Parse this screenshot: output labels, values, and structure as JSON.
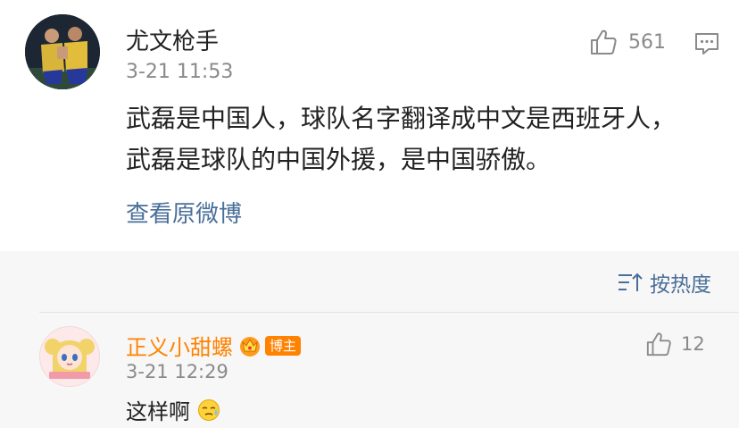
{
  "post": {
    "author_name": "尤文枪手",
    "timestamp": "3-21 11:53",
    "like_count": "561",
    "content": "武磊是中国人，球队名字翻译成中文是西班牙人，武磊是球队的中国外援，是中国骄傲。",
    "view_original_label": "查看原微博",
    "avatar_icon": "football-players-avatar",
    "like_icon": "thumbs-up-icon",
    "comment_icon": "comment-icon"
  },
  "comments_header": {
    "sort_label": "按热度",
    "sort_icon": "sort-icon"
  },
  "comments": [
    {
      "author_name": "正义小甜螺",
      "badge_label": "博主",
      "timestamp": "3-21 12:29",
      "like_count": "12",
      "content": "这样啊",
      "avatar_icon": "anime-girl-avatar",
      "crown_icon": "crown-icon",
      "emoji_icon": "sweat-emoji-icon"
    }
  ],
  "colors": {
    "link_blue": "#4a6f99",
    "orange": "#ff8200",
    "gray_text": "#8a8a8a",
    "comments_bg": "#f7f7f7"
  }
}
